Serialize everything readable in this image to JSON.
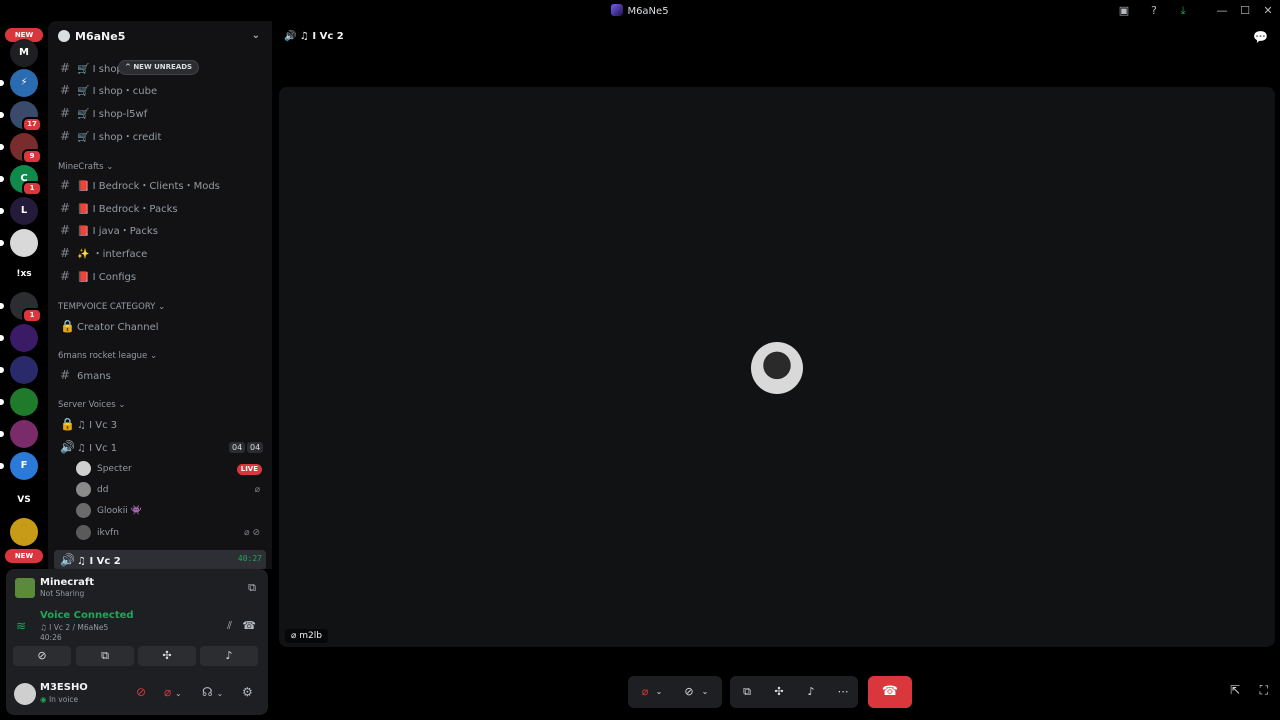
{
  "window": {
    "title": "M6aNe5",
    "icons": [
      "inbox-icon",
      "help-icon",
      "download-icon",
      "minimize-icon",
      "maximize-icon",
      "close-icon"
    ]
  },
  "rail": {
    "new_label": "NEW",
    "new_bottom_label": "NEW",
    "servers": [
      {
        "label": "M",
        "color": "#1e1f22"
      },
      {
        "label": "",
        "color": "#2b6cb0"
      },
      {
        "label": "",
        "color": "#3a4a6b",
        "badge": "17"
      },
      {
        "label": "",
        "color": "#7a2b2b",
        "badge": "9"
      },
      {
        "label": "",
        "color": "#0f8a4a",
        "badge": "1"
      },
      {
        "label": "L",
        "color": "#241a3a"
      },
      {
        "label": "",
        "color": "#d9d9d9"
      },
      {
        "label": "!xs",
        "color": "#000000"
      },
      {
        "label": "",
        "color": "#2b2d31",
        "badge": "1"
      },
      {
        "label": "",
        "color": "#3b1a66"
      },
      {
        "label": "",
        "color": "#2a2a6a"
      },
      {
        "label": "",
        "color": "#1f7a2c"
      },
      {
        "label": "",
        "color": "#7a2b6a"
      },
      {
        "label": "",
        "color": "#2b7ad8"
      },
      {
        "label": "VS",
        "color": "#000000"
      },
      {
        "label": "",
        "color": "#c79a18"
      }
    ]
  },
  "sidebar": {
    "server_name": "M6aNe5",
    "new_unreads": "NEW UNREADS",
    "channels_top": [
      {
        "name": "I shop"
      },
      {
        "name": "I shop・cube"
      },
      {
        "name": "I shop-l5wf"
      },
      {
        "name": "I shop・credit"
      }
    ],
    "cat_minecrafts": "MineCrafts",
    "minecraft_channels": [
      {
        "name": "I Bedrock・Clients・Mods"
      },
      {
        "name": "I Bedrock・Packs"
      },
      {
        "name": "I java・Packs"
      },
      {
        "name": "・interface"
      },
      {
        "name": "I Configs"
      }
    ],
    "cat_tempvoice": "TEMPVOICE CATEGORY",
    "creator_channel": "Creator Channel",
    "cat_6mans": "6mans rocket league",
    "sixmans": "6mans",
    "cat_server_voices": "Server Voices",
    "vc3": "I Vc 3",
    "vc1": "I Vc 1",
    "vc1_count_a": "04",
    "vc1_count_b": "04",
    "vc1_users": [
      {
        "name": "Specter",
        "tag": "LIVE",
        "color": "#cfcfcf"
      },
      {
        "name": "dd",
        "color": "#8a8a8a"
      },
      {
        "name": "Glookii",
        "color": "#6a6a6a"
      },
      {
        "name": "ikvfn",
        "color": "#5a5a5a"
      }
    ],
    "vc2": "I Vc 2",
    "vc2_time": "40:27"
  },
  "panel": {
    "activity_name": "Minecraft",
    "activity_status": "Not Sharing",
    "voice_status": "Voice Connected",
    "voice_location": "I Vc 2 / M6aNe5",
    "voice_time": "40:26",
    "username": "M3ESHO",
    "user_status": "In voice"
  },
  "main": {
    "channel_title": "I Vc 2",
    "tile_name": "m2lb"
  },
  "colors": {
    "accent_red": "#da373c",
    "voice_green": "#23a55a"
  }
}
